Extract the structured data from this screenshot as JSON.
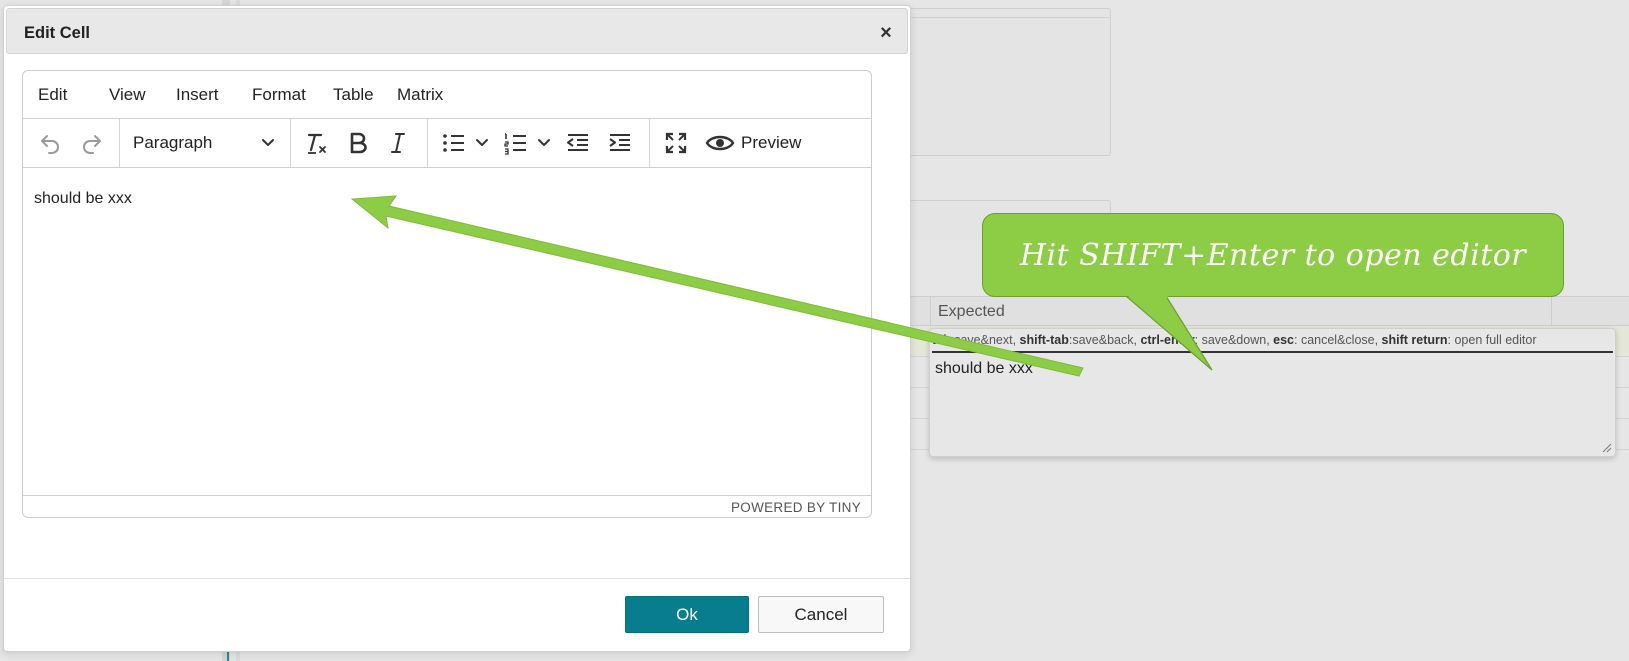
{
  "background": {
    "column_header": "Expected"
  },
  "cell_editor": {
    "hint": [
      {
        "key": "tab",
        "desc": ":save&next, "
      },
      {
        "key": "shift-tab",
        "desc": ":save&back, "
      },
      {
        "key": "ctrl-enter",
        "desc": ": save&down, "
      },
      {
        "key": "esc",
        "desc": ": cancel&close, "
      },
      {
        "key": "shift return",
        "desc": ": open full editor"
      }
    ],
    "value": "should be xxx"
  },
  "dialog": {
    "title": "Edit Cell",
    "close_icon": "close-icon",
    "ok_label": "Ok",
    "cancel_label": "Cancel"
  },
  "editor": {
    "menus": [
      "Edit",
      "View",
      "Insert",
      "Format",
      "Table",
      "Matrix"
    ],
    "block_format": "Paragraph",
    "preview_label": "Preview",
    "content": "should be xxx",
    "branding": "POWERED BY TINY",
    "toolbar_icons": [
      "undo-icon",
      "redo-icon",
      "clear-formatting-icon",
      "bold-icon",
      "italic-icon",
      "bullet-list-icon",
      "numbered-list-icon",
      "outdent-icon",
      "indent-icon",
      "fullscreen-icon",
      "eye-icon"
    ]
  },
  "annotation": {
    "callout_text": "Hit SHIFT+Enter to open editor",
    "color": "#8dcc45"
  },
  "colors": {
    "primary_button": "#087d8e",
    "accent_green": "#8dcc45"
  }
}
